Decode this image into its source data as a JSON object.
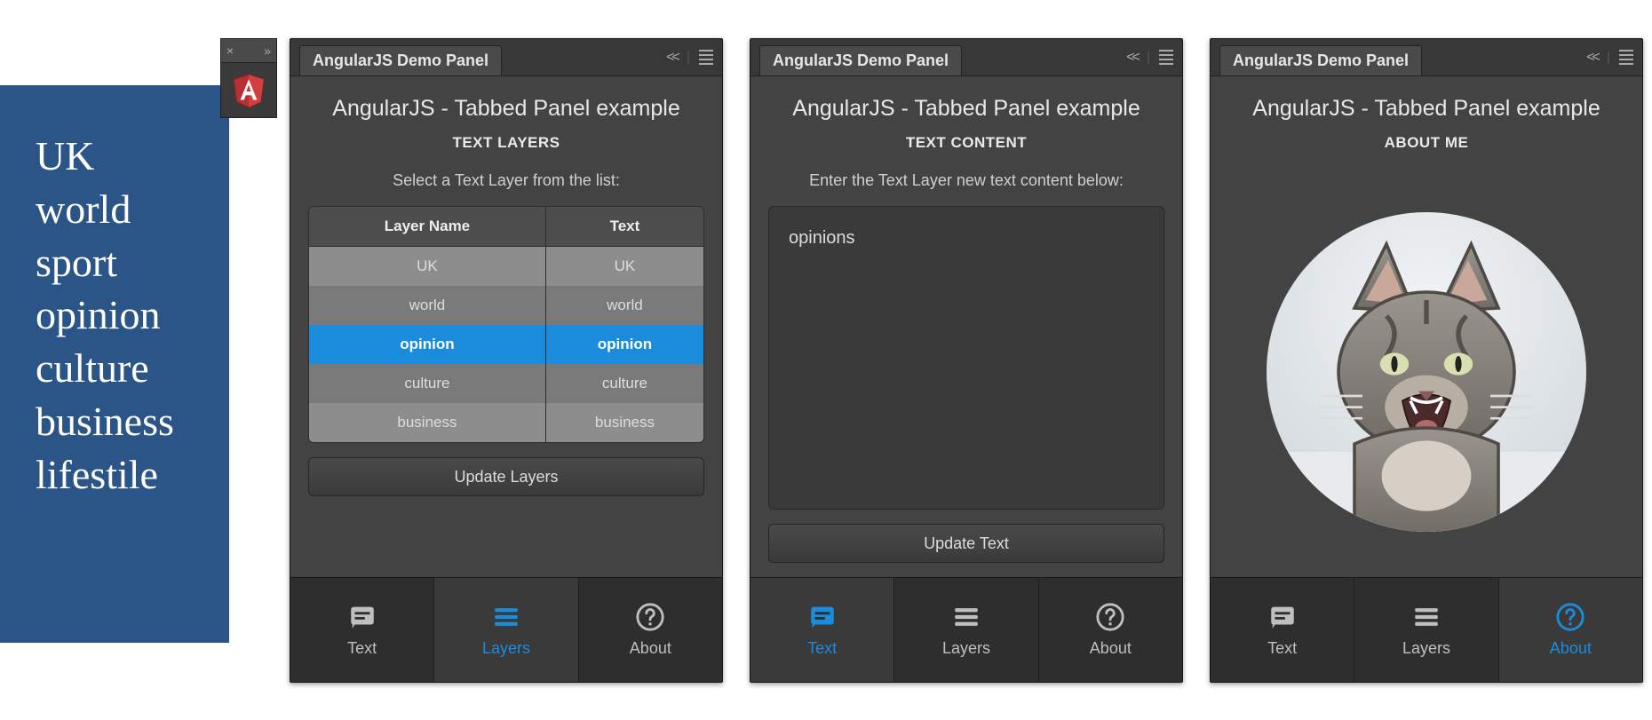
{
  "colors": {
    "accent": "#1b8cdc",
    "panel_dark": "#3f3f3f",
    "selection": "#1b8cdc"
  },
  "sidebar_words": [
    "UK",
    "world",
    "sport",
    "opinion",
    "culture",
    "business",
    "lifestile"
  ],
  "tiny_tab": {
    "close_glyph": "×",
    "expand_glyph": "»",
    "logo_name": "angular-logo"
  },
  "panel_common": {
    "title": "AngularJS Demo Panel",
    "heading": "AngularJS - Tabbed Panel example",
    "collapse_glyph": "<<"
  },
  "layers_panel": {
    "subheading": "TEXT LAYERS",
    "instruction": "Select a Text Layer from the list:",
    "table": {
      "headers": [
        "Layer Name",
        "Text"
      ],
      "rows": [
        {
          "name": "UK",
          "text": "UK",
          "selected": false
        },
        {
          "name": "world",
          "text": "world",
          "selected": false
        },
        {
          "name": "opinion",
          "text": "opinion",
          "selected": true
        },
        {
          "name": "culture",
          "text": "culture",
          "selected": false
        },
        {
          "name": "business",
          "text": "business",
          "selected": false
        }
      ]
    },
    "button": "Update Layers",
    "active_tab": "Layers"
  },
  "text_panel": {
    "subheading": "TEXT CONTENT",
    "instruction": "Enter the Text Layer new text content below:",
    "textarea_value": "opinions",
    "button": "Update Text",
    "active_tab": "Text"
  },
  "about_panel": {
    "subheading": "ABOUT ME",
    "avatar_alt": "cat-avatar",
    "active_tab": "About"
  },
  "nav": {
    "text": "Text",
    "layers": "Layers",
    "about": "About"
  }
}
